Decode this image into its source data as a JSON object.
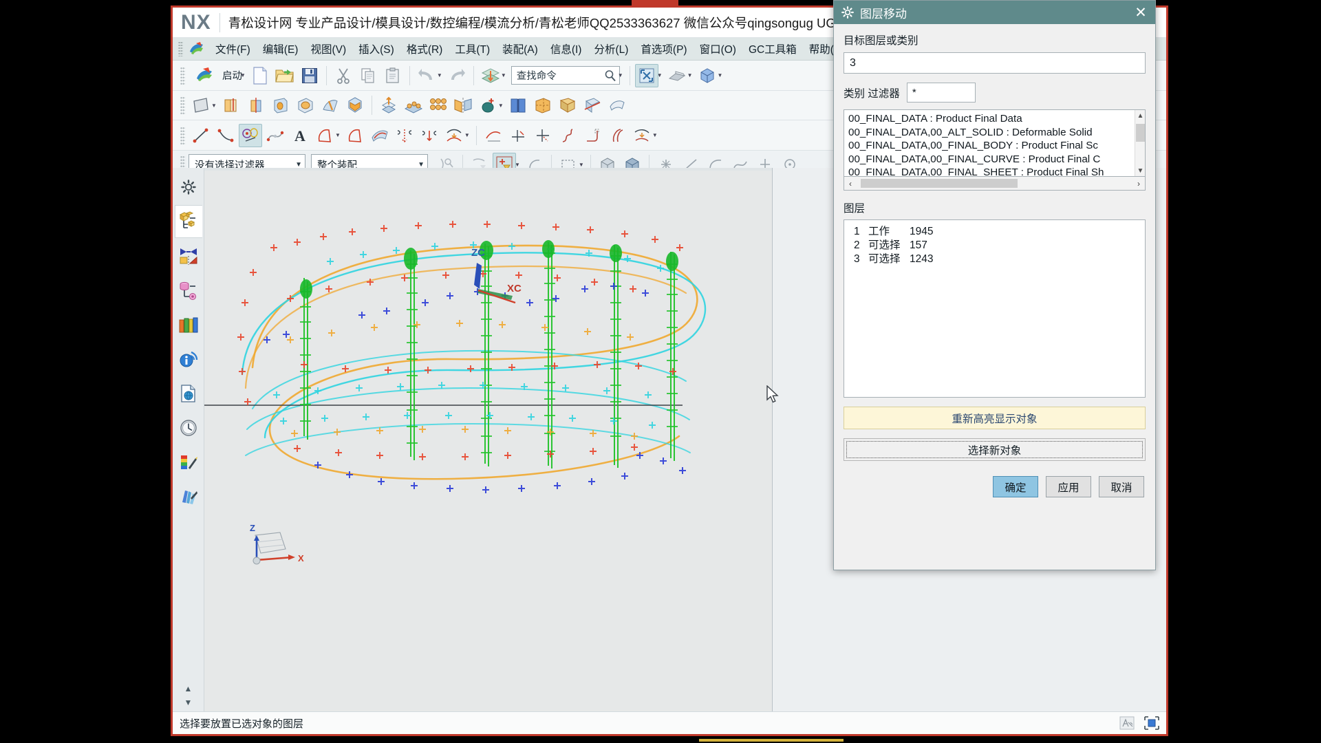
{
  "app": {
    "logo": "NX",
    "title": "青松设计网 专业产品设计/模具设计/数控编程/模流分析/青松老师QQ2533363627 微信公众号qingsongug UG设计QQ群"
  },
  "menubar": {
    "items": [
      {
        "label": "文件(F)",
        "name": "menu-file"
      },
      {
        "label": "编辑(E)",
        "name": "menu-edit"
      },
      {
        "label": "视图(V)",
        "name": "menu-view"
      },
      {
        "label": "插入(S)",
        "name": "menu-insert"
      },
      {
        "label": "格式(R)",
        "name": "menu-format"
      },
      {
        "label": "工具(T)",
        "name": "menu-tools"
      },
      {
        "label": "装配(A)",
        "name": "menu-assemblies"
      },
      {
        "label": "信息(I)",
        "name": "menu-information"
      },
      {
        "label": "分析(L)",
        "name": "menu-analysis"
      },
      {
        "label": "首选项(P)",
        "name": "menu-preferences"
      },
      {
        "label": "窗口(O)",
        "name": "menu-window"
      },
      {
        "label": "GC工具箱",
        "name": "menu-gc-toolbox"
      },
      {
        "label": "帮助(H)",
        "name": "menu-help"
      }
    ]
  },
  "toolbar": {
    "start_label": "启动",
    "search_value": "查找命令"
  },
  "selection_bar": {
    "filter": "没有选择过滤器",
    "scope": "整个装配"
  },
  "dialog": {
    "title": "图层移动",
    "close_label": "✕",
    "target_layer_label": "目标图层或类别",
    "target_layer_value": "3",
    "category_filter_label": "类别 过滤器",
    "category_filter_value": "*",
    "category_items": [
      "00_FINAL_DATA : Product Final Data",
      "00_FINAL_DATA,00_ALT_SOLID : Deformable Solid",
      "00_FINAL_DATA,00_FINAL_BODY : Product Final Sc",
      "00_FINAL_DATA,00_FINAL_CURVE : Product Final C",
      "00_FINAL_DATA,00_FINAL_SHEET : Product Final Sh"
    ],
    "layers_label": "图层",
    "layers": [
      {
        "num": "1",
        "state": "工作",
        "count": "1945"
      },
      {
        "num": "2",
        "state": "可选择",
        "count": "157"
      },
      {
        "num": "3",
        "state": "可选择",
        "count": "1243"
      }
    ],
    "rehighlight_label": "重新高亮显示对象",
    "select_new_label": "选择新对象",
    "ok_label": "确定",
    "apply_label": "应用",
    "cancel_label": "取消",
    "accent_color": "#5f8a8b",
    "highlight_color": "#fdf6d8",
    "primary_color": "#8fc5e2"
  },
  "status": {
    "cue": "选择要放置已选对象的图层"
  },
  "viewport": {
    "wcs_zc": "ZC",
    "wcs_xc": "XC",
    "triad_z": "Z",
    "triad_x": "X"
  },
  "resource_bar": {
    "items": [
      {
        "name": "settings-icon",
        "label": "设置"
      },
      {
        "name": "assembly-navigator-icon",
        "label": "装配导航器"
      },
      {
        "name": "constraint-navigator-icon",
        "label": "约束导航器"
      },
      {
        "name": "part-navigator-icon",
        "label": "部件导航器"
      },
      {
        "name": "reuse-library-icon",
        "label": "重用库"
      },
      {
        "name": "hd3d-tools-icon",
        "label": "HD3D 工具"
      },
      {
        "name": "web-browser-icon",
        "label": "Web 浏览器"
      },
      {
        "name": "history-icon",
        "label": "历史记录"
      },
      {
        "name": "system-materials-icon",
        "label": "系统材料"
      },
      {
        "name": "system-scene-icon",
        "label": "系统可视化场景"
      }
    ]
  }
}
